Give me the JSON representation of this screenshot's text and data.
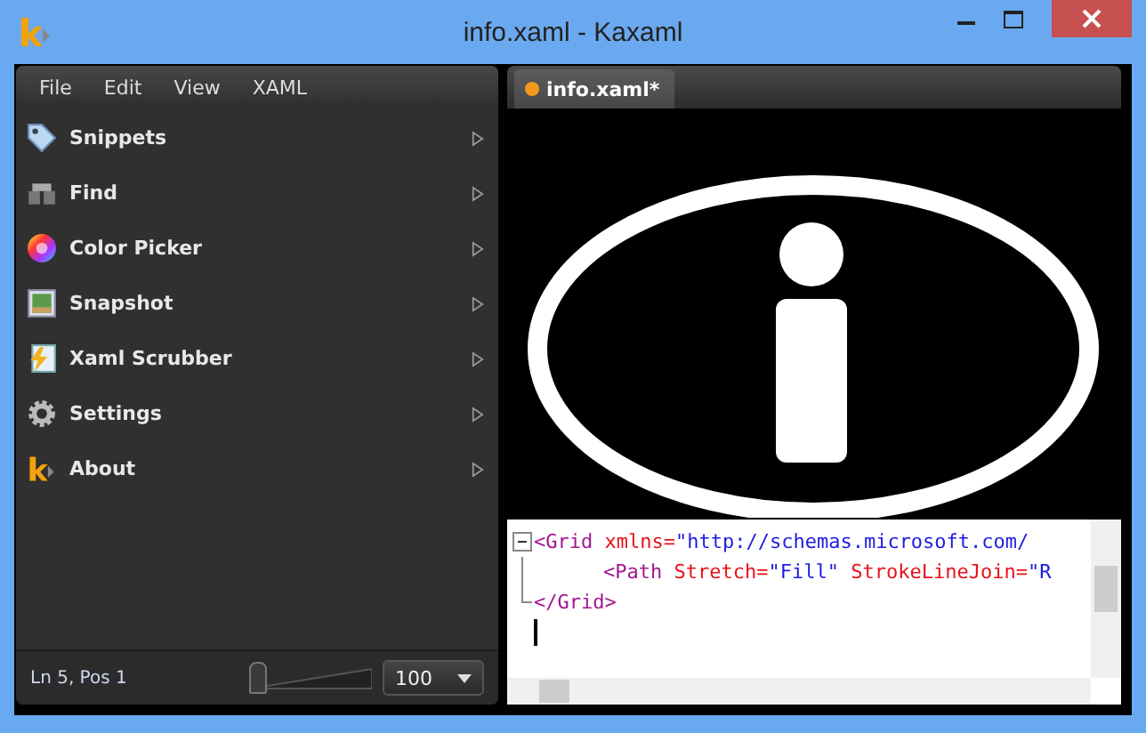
{
  "window": {
    "title": "info.xaml - Kaxaml"
  },
  "menu": [
    "File",
    "Edit",
    "View",
    "XAML"
  ],
  "tools": [
    {
      "label": "Snippets"
    },
    {
      "label": "Find"
    },
    {
      "label": "Color Picker"
    },
    {
      "label": "Snapshot"
    },
    {
      "label": "Xaml Scrubber"
    },
    {
      "label": "Settings"
    },
    {
      "label": "About"
    }
  ],
  "status_bar": {
    "position": "Ln 5, Pos 1",
    "zoom": {
      "level": 0.05
    },
    "zoom_value": "100"
  },
  "tabs": [
    {
      "label": "info.xaml*",
      "selected": true,
      "modified": true
    }
  ],
  "editor": {
    "lines": [
      {
        "kind": "open",
        "tokens": [
          {
            "kind": "tag",
            "text": "<Grid"
          },
          {
            "kind": "attr",
            "text": " xmlns="
          },
          {
            "kind": "value",
            "text": "\"http://schemas.microsoft.com/"
          }
        ]
      },
      {
        "kind": "inner",
        "tokens": [
          {
            "kind": "tag",
            "text": "<Path"
          },
          {
            "kind": "attr",
            "text": " Stretch="
          },
          {
            "kind": "value",
            "text": "\"Fill\""
          },
          {
            "kind": "attr",
            "text": " StrokeLineJoin="
          },
          {
            "kind": "value",
            "text": "\"R"
          }
        ]
      },
      {
        "kind": "end",
        "tokens": [
          {
            "kind": "tag",
            "text": "</Grid>"
          }
        ]
      }
    ]
  }
}
